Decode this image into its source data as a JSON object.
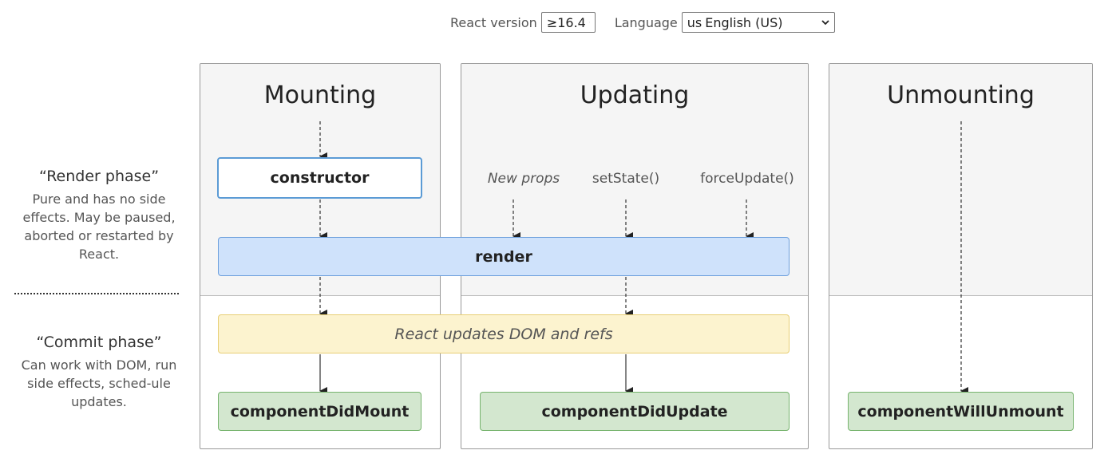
{
  "controls": {
    "version_label": "React version",
    "version_value": "≥16.4",
    "language_label": "Language",
    "language_flag": "us",
    "language_value": "English (US)"
  },
  "panels": {
    "mounting": "Mounting",
    "updating": "Updating",
    "unmounting": "Unmounting"
  },
  "methods": {
    "constructor": "constructor",
    "render": "render",
    "dom_refs": "React updates DOM and refs",
    "did_mount": "componentDidMount",
    "did_update": "componentDidUpdate",
    "will_unmount": "componentWillUnmount"
  },
  "triggers": {
    "new_props": "New props",
    "set_state": "setState()",
    "force_update": "forceUpdate()"
  },
  "phases": {
    "render": {
      "title": "“Render phase”",
      "description": "Pure and has no side effects. May be paused, aborted or restarted by React."
    },
    "commit": {
      "title": "“Commit phase”",
      "description": "Can work with DOM, run side effects, sched-ule updates."
    }
  },
  "colors": {
    "render_box": "#cfe2fb",
    "dom_box": "#fcf3cf",
    "lifecycle_box": "#d3e7cf",
    "constructor_border": "#5b9bd5"
  }
}
